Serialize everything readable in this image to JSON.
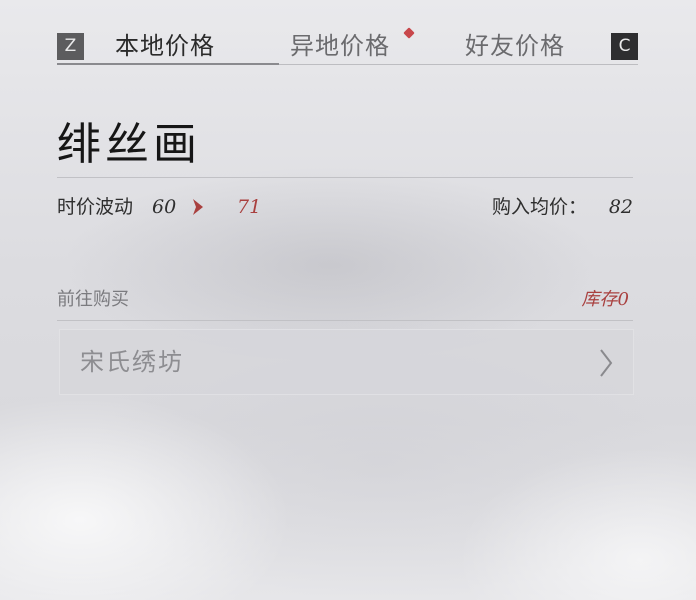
{
  "tabs": {
    "prev_key": "Z",
    "next_key": "C",
    "items": [
      {
        "label": "本地价格",
        "active": true
      },
      {
        "label": "异地价格",
        "active": false,
        "has_notification": true
      },
      {
        "label": "好友价格",
        "active": false
      }
    ]
  },
  "item": {
    "name": "绯丝画",
    "fluctuation_label": "时价波动",
    "fluctuation_from": "60",
    "fluctuation_to": "71",
    "avg_buy_label": "购入均价：",
    "avg_buy_value": "82"
  },
  "purchase": {
    "label": "前往购买",
    "stock_text": "库存0",
    "shops": [
      {
        "name": "宋氏绣坊"
      }
    ]
  },
  "colors": {
    "accent_red": "#a9403f",
    "notification": "#c8474b",
    "active_text": "#2b2b2b",
    "inactive_text": "#6b6b6e"
  },
  "icons": {
    "trend_arrow": "chevron-right-icon",
    "shop_arrow": "chevron-right-icon"
  }
}
